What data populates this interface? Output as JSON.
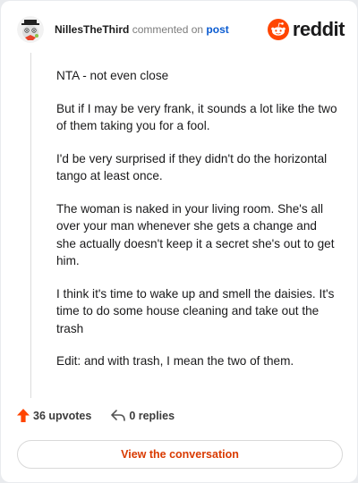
{
  "comment": {
    "username": "NillesTheThird",
    "action_text": "commented on",
    "post_link": "post",
    "paragraphs": [
      "NTA - not even close",
      "But if I may be very frank, it sounds a lot like the two of them taking you for a fool.",
      "I'd be very surprised if they didn't do the horizontal tango at least once.",
      "The woman is naked in your living room. She's all over your man whenever she gets a change and she actually doesn't keep it a secret she's out to get him.",
      "I think it's time to wake up and smell the daisies. It's time to do some house cleaning and take out the trash",
      "Edit: and with trash, I mean the two of them."
    ]
  },
  "brand": {
    "name": "reddit",
    "color": "#ff4500",
    "icon": "reddit-snoo-icon"
  },
  "actions": {
    "upvotes_label": "36 upvotes",
    "replies_label": "0 replies",
    "upvote_color": "#ff4500"
  },
  "cta": {
    "label": "View the conversation",
    "color": "#d93a00"
  }
}
